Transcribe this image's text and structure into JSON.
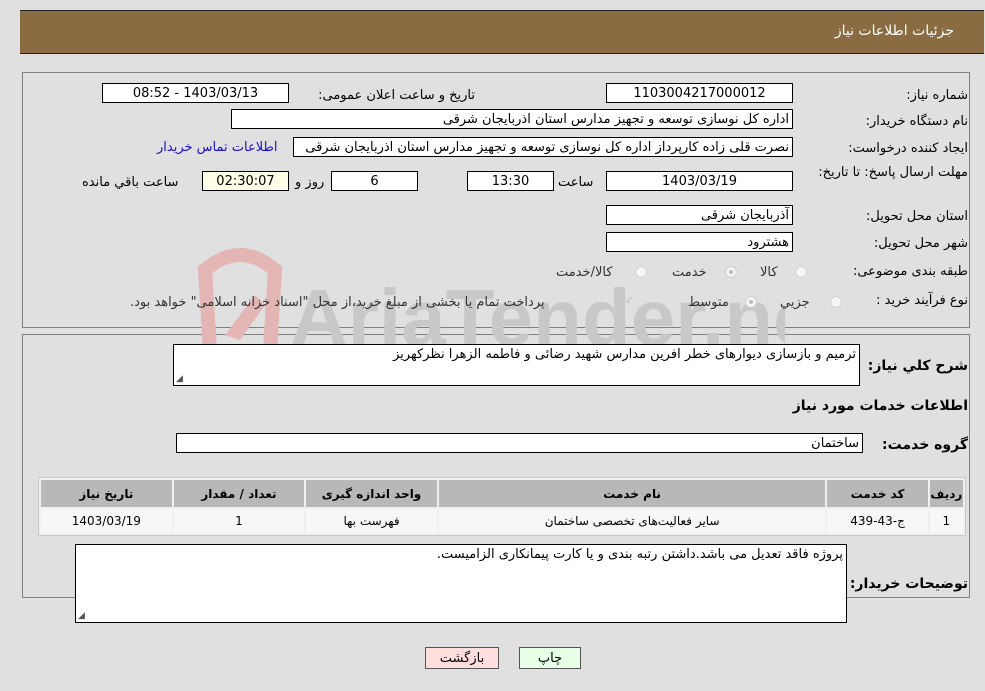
{
  "header": {
    "title": "جزئیات اطلاعات نیاز"
  },
  "form": {
    "need_number": {
      "label": "شماره نیاز:",
      "value": "1103004217000012"
    },
    "announce_datetime": {
      "label": "تاریخ و ساعت اعلان عمومی:",
      "value": "1403/03/13 - 08:52"
    },
    "buyer_org": {
      "label": "نام دستگاه خریدار:",
      "value": "اداره کل نوسازی  توسعه و تجهیز مدارس استان اذربایجان شرقی"
    },
    "requester": {
      "label": "ایجاد کننده درخواست:",
      "value": "نصرت قلی زاده کارپرداز اداره کل نوسازی  توسعه و تجهیز مدارس استان اذربایجان شرقی"
    },
    "buyer_contact_link": "اطلاعات تماس خریدار",
    "deadline": {
      "label": "مهلت ارسال پاسخ: تا تاریخ:",
      "date": "1403/03/19",
      "time_label": "ساعت",
      "time": "13:30",
      "days": "6",
      "days_label": "روز و",
      "remaining": "02:30:07",
      "remaining_label": "ساعت باقي مانده"
    },
    "province": {
      "label": "استان محل تحویل:",
      "value": "آذربایجان شرقی"
    },
    "city": {
      "label": "شهر محل تحویل:",
      "value": "هشترود"
    },
    "category": {
      "label": "طبقه بندی موضوعی:",
      "options": [
        "کالا",
        "خدمت",
        "کالا/خدمت"
      ],
      "selected": "خدمت"
    },
    "purchase_type": {
      "label": "نوع فرآیند خرید :",
      "options": [
        "جزيي",
        "متوسط"
      ],
      "selected": "متوسط",
      "treasury_note": "پرداخت تمام یا بخشی از مبلغ خرید،از محل \"اسناد خزانه اسلامی\" خواهد بود."
    }
  },
  "details": {
    "general_desc_label": "شرح کلي نياز:",
    "general_desc": "ترمیم و بازسازی دیوارهای خطر افرین مدارس شهید رضائی و فاطمه الزهرا نظرکهریز",
    "services_heading": "اطلاعات خدمات مورد نياز",
    "service_group_label": "گروه خدمت:",
    "service_group": "ساختمان",
    "table": {
      "headers": [
        "رديف",
        "کد خدمت",
        "نام خدمت",
        "واحد اندازه گیری",
        "تعداد / مقدار",
        "تاریخ نیاز"
      ],
      "rows": [
        [
          "1",
          "ج-43-439",
          "سایر فعالیت‌های تخصصی ساختمان",
          "فهرست بها",
          "1",
          "1403/03/19"
        ]
      ]
    },
    "buyer_notes_label": "توضیحات خریدار:",
    "buyer_notes": "پروژه فاقد تعدیل می باشد.داشتن رتبه بندی و یا کارت پیمانکاری الزامیست."
  },
  "buttons": {
    "print": "چاپ",
    "back": "بازگشت"
  },
  "watermark": {
    "text": "AriaTender.neT"
  }
}
